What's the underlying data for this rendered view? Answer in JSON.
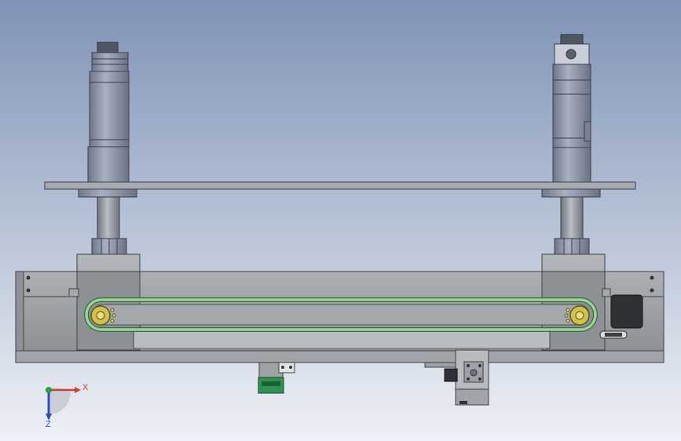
{
  "viewport": {
    "background_top": "#7f93b6",
    "background_bottom": "#eef1f6"
  },
  "triad": {
    "x_label": "X",
    "z_label": "Z",
    "x_color": "#d83a2d",
    "y_color": "#27a43a",
    "z_color": "#2a4ec7"
  },
  "colors": {
    "metal": "#9aa0a6",
    "metal_dark": "#5f666d",
    "motor_body": "#8d95a7",
    "plate": "#a7abb0",
    "belt": "#9bd49a",
    "belt_edge": "#3b6b3a",
    "pulley": "#d2c24a",
    "sensor_green": "#2f9152",
    "black_block": "#2e3136"
  }
}
